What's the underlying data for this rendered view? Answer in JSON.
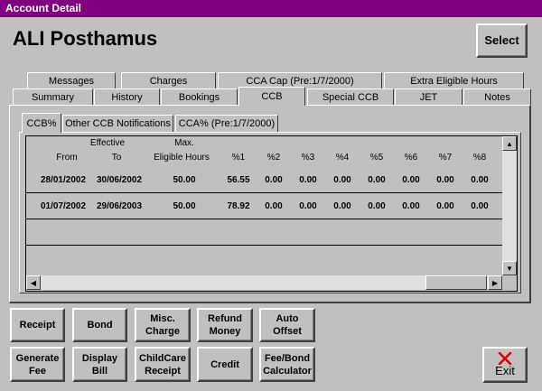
{
  "window": {
    "title": "Account Detail"
  },
  "header": {
    "account_name": "ALI Posthamus",
    "select_label": "Select"
  },
  "tabs_row1": [
    "Messages",
    "Charges",
    "CCA Cap (Pre:1/7/2000)",
    "Extra Eligible Hours"
  ],
  "tabs_row2": [
    "Summary",
    "History",
    "Bookings",
    "CCB",
    "Special CCB",
    "JET",
    "Notes"
  ],
  "active_tab": "CCB",
  "subtabs": [
    "CCB%",
    "Other CCB Notifications",
    "CCA% (Pre:1/7/2000)"
  ],
  "active_subtab": "CCB%",
  "grid": {
    "header_top": {
      "effective": "Effective",
      "max": "Max."
    },
    "columns": [
      "From",
      "To",
      "Eligible Hours",
      "%1",
      "%2",
      "%3",
      "%4",
      "%5",
      "%6",
      "%7",
      "%8"
    ],
    "rows": [
      [
        "28/01/2002",
        "30/06/2002",
        "50.00",
        "56.55",
        "0.00",
        "0.00",
        "0.00",
        "0.00",
        "0.00",
        "0.00",
        "0.00"
      ],
      [
        "01/07/2002",
        "29/06/2003",
        "50.00",
        "78.92",
        "0.00",
        "0.00",
        "0.00",
        "0.00",
        "0.00",
        "0.00",
        "0.00"
      ]
    ]
  },
  "buttons": {
    "receipt": "Receipt",
    "bond": "Bond",
    "misc_charge": "Misc.\nCharge",
    "refund_money": "Refund\nMoney",
    "auto_offset": "Auto\nOffset",
    "generate_fee": "Generate\nFee",
    "display_bill": "Display\nBill",
    "childcare_receipt": "ChildCare\nReceipt",
    "credit": "Credit",
    "fee_bond_calculator": "Fee/Bond\nCalculator",
    "exit": "Exit"
  },
  "colors": {
    "titlebar": "#800080",
    "face": "#c0c0c0",
    "exit_icon": "#e00000"
  },
  "icons": {
    "exit": "close-x-icon"
  }
}
